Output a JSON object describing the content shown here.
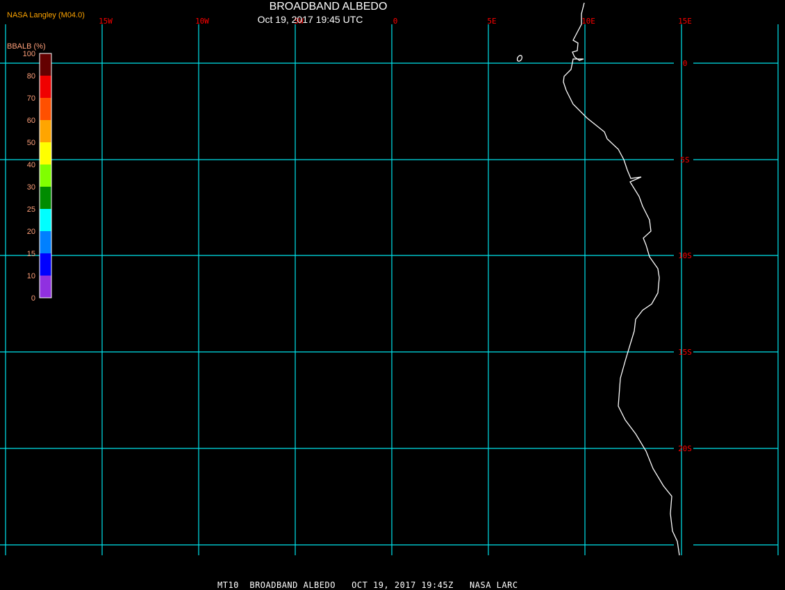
{
  "title": "BROADBAND ALBEDO",
  "subtitle": "Oct 19, 2017 19:45 UTC",
  "credit": "NASA Langley (M04.0)",
  "footer": "MT10  BROADBAND ALBEDO   OCT 19, 2017 19:45Z   NASA LARC",
  "colors": {
    "background": "#000000",
    "grid": "#00e5ee",
    "grid_labels": "#ff0000",
    "coastline": "#ffffff",
    "legend_labels": "#ffa07a"
  },
  "map": {
    "longitude_labels": [
      "15W",
      "10W",
      "5W",
      "0",
      "5E",
      "10E",
      "15E"
    ],
    "latitude_labels": [
      "0",
      "5S",
      "10S",
      "15S",
      "20S"
    ]
  },
  "legend": {
    "title": "BBALB (%)",
    "tick_labels": [
      "100",
      "80",
      "70",
      "60",
      "50",
      "40",
      "30",
      "25",
      "20",
      "15",
      "10",
      "0"
    ],
    "bins": [
      {
        "from": 80,
        "to": 100,
        "color": "#640000"
      },
      {
        "from": 70,
        "to": 80,
        "color": "#f00000"
      },
      {
        "from": 60,
        "to": 70,
        "color": "#ff5000"
      },
      {
        "from": 50,
        "to": 60,
        "color": "#ffa500"
      },
      {
        "from": 40,
        "to": 50,
        "color": "#ffff00"
      },
      {
        "from": 30,
        "to": 40,
        "color": "#80ff00"
      },
      {
        "from": 25,
        "to": 30,
        "color": "#008c00"
      },
      {
        "from": 20,
        "to": 25,
        "color": "#00ffff"
      },
      {
        "from": 15,
        "to": 20,
        "color": "#0080ff"
      },
      {
        "from": 10,
        "to": 15,
        "color": "#0000ff"
      },
      {
        "from": 0,
        "to": 10,
        "color": "#9030e0"
      }
    ]
  }
}
